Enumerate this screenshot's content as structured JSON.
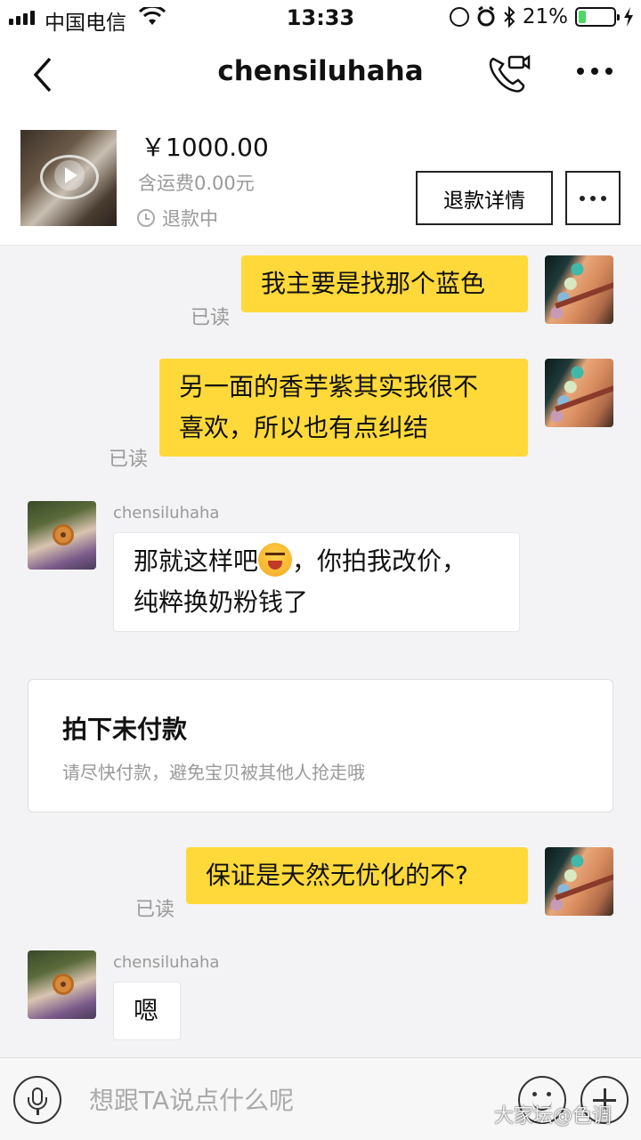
{
  "status_bar": {
    "carrier": "中国电信",
    "time": "13:33",
    "battery_text": "21%",
    "battery_level": 0.21,
    "icons": [
      "signal-icon",
      "wifi-icon",
      "orientation-lock-icon",
      "alarm-icon",
      "bluetooth-icon",
      "battery-icon",
      "charging-icon"
    ]
  },
  "nav": {
    "title": "chensiluhaha",
    "icons": [
      "back-icon",
      "video-call-icon",
      "more-icon"
    ]
  },
  "product": {
    "price": "￥1000.00",
    "shipping": "含运费0.00元",
    "status": "退款中",
    "refund_button": "退款详情",
    "icons": [
      "play-icon",
      "clock-icon",
      "more-icon"
    ]
  },
  "messages": [
    {
      "from": "me",
      "text": "我主要是找那个蓝色",
      "read": "已读"
    },
    {
      "from": "me",
      "text": "另一面的香芋紫其实我很不喜欢，所以也有点纠结",
      "text_line1": "另一面的香芋紫其实我很不",
      "text_line2": "喜欢，所以也有点纠结",
      "read": "已读"
    },
    {
      "from": "them",
      "sender": "chensiluhaha",
      "text_before_emoji": "那就这样吧",
      "emoji": "grinning-squint-emoji",
      "text_after_emoji": "，你拍我改价，",
      "text_line2": "纯粹换奶粉钱了"
    },
    {
      "from": "me",
      "text": "保证是天然无优化的不?",
      "read": "已读"
    },
    {
      "from": "them",
      "sender": "chensiluhaha",
      "text": "嗯"
    }
  ],
  "system_card": {
    "title": "拍下未付款",
    "description": "请尽快付款，避免宝贝被其他人抢走哦"
  },
  "input_bar": {
    "placeholder": "想跟TA说点什么呢",
    "icons": [
      "microphone-icon",
      "emoji-icon",
      "plus-icon"
    ]
  },
  "watermark": "大家坛@色调",
  "colors": {
    "my_bubble": "#ffd93a",
    "their_bubble": "#ffffff",
    "chat_background": "#f3f3f5",
    "battery": "#4cd964"
  }
}
